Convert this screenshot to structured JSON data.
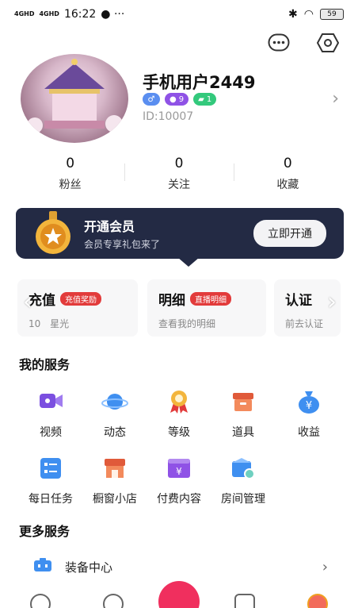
{
  "status_bar": {
    "signal_1": "4GHD",
    "signal_2": "4GHD",
    "time": "16:22",
    "battery": "59"
  },
  "profile": {
    "name": "手机用户2449",
    "level_badge": "9",
    "green_badge": "1",
    "id_text": "ID:10007"
  },
  "stats": [
    {
      "value": "0",
      "label": "粉丝"
    },
    {
      "value": "0",
      "label": "关注"
    },
    {
      "value": "0",
      "label": "收藏"
    }
  ],
  "vip": {
    "title": "开通会员",
    "subtitle": "会员专享礼包来了",
    "button": "立即开通"
  },
  "cards": [
    {
      "title": "充值",
      "tag": "充值奖励",
      "desc_value": "10",
      "desc": "星光"
    },
    {
      "title": "明细",
      "tag": "直播明细",
      "desc": "查看我的明细"
    },
    {
      "title": "认证",
      "desc": "前去认证"
    }
  ],
  "my_services": {
    "title": "我的服务",
    "items": [
      {
        "label": "视频",
        "icon": "video-icon",
        "color": "#7b4fe0"
      },
      {
        "label": "动态",
        "icon": "planet-icon",
        "color": "#3f8ff0"
      },
      {
        "label": "等级",
        "icon": "medal-icon",
        "color": "#f0a020"
      },
      {
        "label": "道具",
        "icon": "box-icon",
        "color": "#f07a4a"
      },
      {
        "label": "收益",
        "icon": "money-bag-icon",
        "color": "#3f8ff0"
      },
      {
        "label": "每日任务",
        "icon": "task-icon",
        "color": "#3f8ff0"
      },
      {
        "label": "橱窗小店",
        "icon": "shop-icon",
        "color": "#f07a4a"
      },
      {
        "label": "付费内容",
        "icon": "paid-content-icon",
        "color": "#8f52e6"
      },
      {
        "label": "房间管理",
        "icon": "room-icon",
        "color": "#3f8ff0"
      }
    ]
  },
  "more_services": {
    "title": "更多服务",
    "items": [
      {
        "label": "装备中心",
        "icon": "equipment-icon"
      }
    ]
  }
}
